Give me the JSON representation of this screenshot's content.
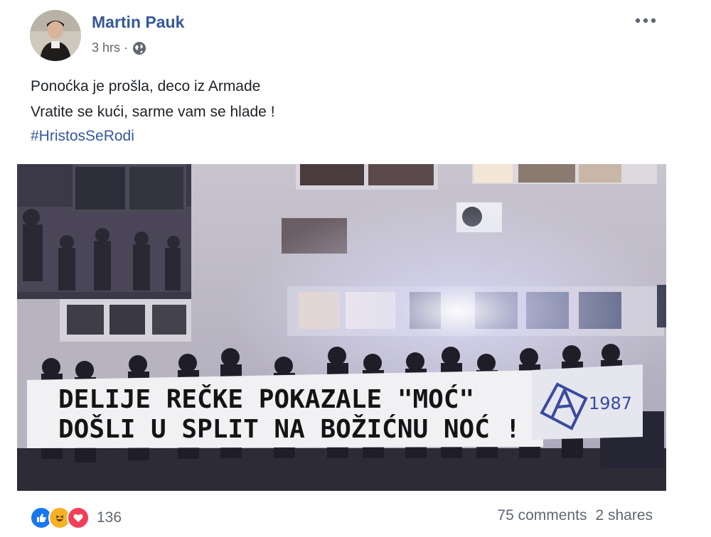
{
  "post": {
    "author": "Martin Pauk",
    "time": "3 hrs ·",
    "privacy_icon": "globe-icon",
    "more_icon": "more-options-icon",
    "text_lines": [
      "Ponoćka je prošla, deco iz Armade",
      "Vratite se kući, sarme vam se hlade !"
    ],
    "hashtag": "#HristosSeRodi"
  },
  "photo": {
    "banner_line1": "DELIJE REČKE POKAZALE \"MOĆ\"",
    "banner_line2": "DOŠLI U SPLIT NA BOŽIĆNU NOĆ !",
    "banner_mark": "1987"
  },
  "footer": {
    "reactions": [
      "like-icon",
      "haha-icon",
      "love-icon"
    ],
    "reaction_count": "136",
    "comments": "75 comments",
    "shares": "2 shares"
  },
  "colors": {
    "link": "#365899",
    "like": "#1877f2",
    "haha": "#f7b125",
    "love": "#f33e58"
  }
}
